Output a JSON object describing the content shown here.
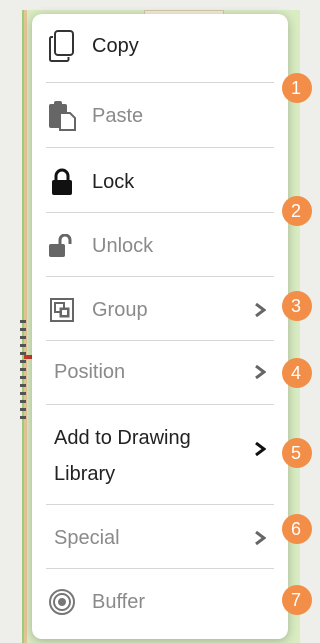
{
  "menu": {
    "items": [
      {
        "label": "Copy",
        "icon": "copy-icon",
        "enabled": true,
        "submenu": false
      },
      {
        "label": "Paste",
        "icon": "paste-icon",
        "enabled": false,
        "submenu": false
      },
      {
        "label": "Lock",
        "icon": "lock-icon",
        "enabled": true,
        "submenu": false
      },
      {
        "label": "Unlock",
        "icon": "unlock-icon",
        "enabled": false,
        "submenu": false
      },
      {
        "label": "Group",
        "icon": "group-icon",
        "enabled": false,
        "submenu": true
      },
      {
        "label": "Position",
        "icon": "",
        "enabled": false,
        "submenu": true
      },
      {
        "label": "Add to Drawing Library",
        "icon": "",
        "enabled": true,
        "submenu": true
      },
      {
        "label": "Special",
        "icon": "",
        "enabled": false,
        "submenu": true
      },
      {
        "label": "Buffer",
        "icon": "buffer-icon",
        "enabled": false,
        "submenu": false
      }
    ]
  },
  "badges": [
    "1",
    "2",
    "3",
    "4",
    "5",
    "6",
    "7"
  ],
  "colors": {
    "badge": "#f28e47",
    "enabled_text": "#222222",
    "disabled_text": "#8a8a8a",
    "menu_bg": "#ffffff",
    "map_bg": "#d9ecc2"
  }
}
